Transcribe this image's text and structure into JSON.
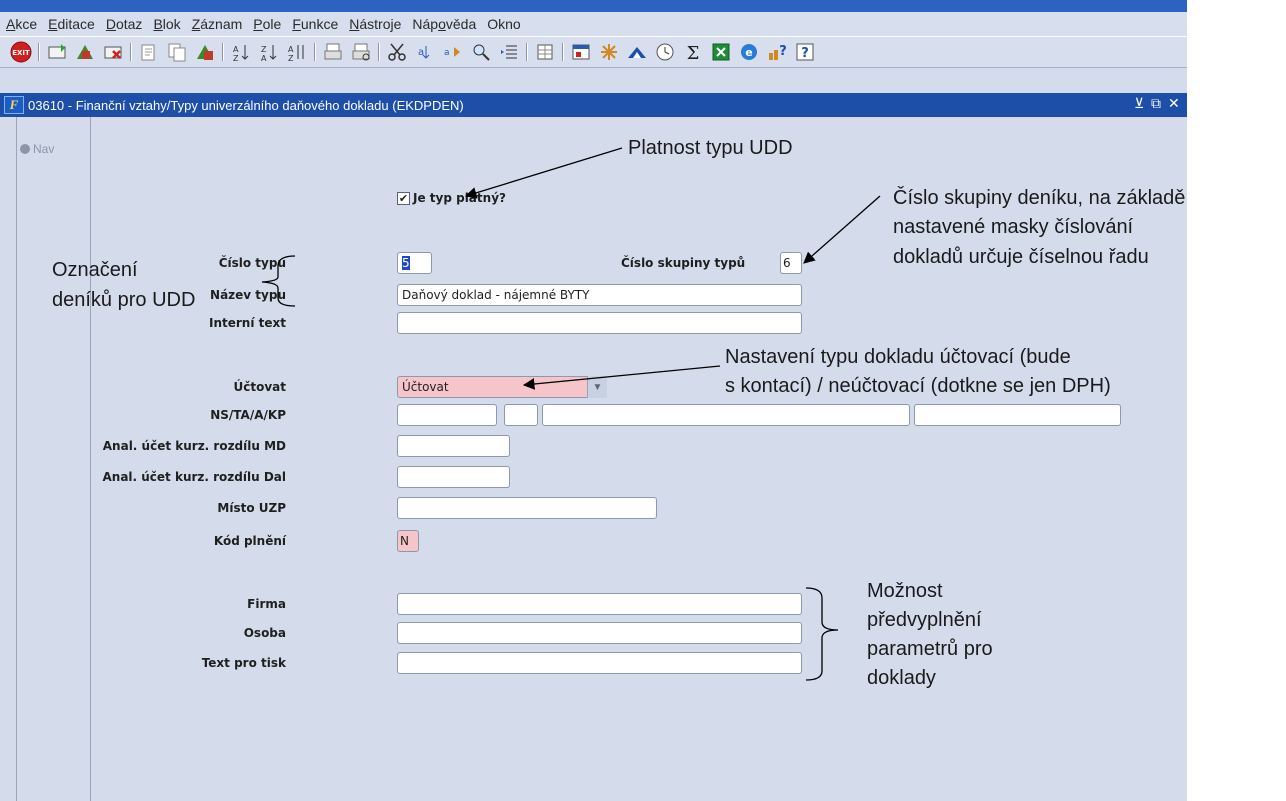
{
  "menubar": {
    "items": [
      {
        "pre": "",
        "key": "A",
        "post": "kce"
      },
      {
        "pre": "",
        "key": "E",
        "post": "ditace"
      },
      {
        "pre": "",
        "key": "D",
        "post": "otaz"
      },
      {
        "pre": "",
        "key": "B",
        "post": "lok"
      },
      {
        "pre": "",
        "key": "Z",
        "post": "áznam"
      },
      {
        "pre": "",
        "key": "P",
        "post": "ole"
      },
      {
        "pre": "",
        "key": "F",
        "post": "unkce"
      },
      {
        "pre": "",
        "key": "N",
        "post": "ástroje"
      },
      {
        "pre": "Náp",
        "key": "o",
        "post": "věda"
      },
      {
        "pre": "Okno",
        "key": "",
        "post": ""
      }
    ]
  },
  "toolbar": {
    "exit_label": "EXIT",
    "icons": [
      "exit-icon",
      "insert-record-icon",
      "duplicate-record-icon",
      "delete-record-icon",
      "cut-icon",
      "copy-icon",
      "paste-icon",
      "sort-asc-icon",
      "sort-desc-icon",
      "sort-multi-icon",
      "print-icon",
      "print-preview-icon",
      "scissors-icon",
      "merge-icon",
      "navigate-icon",
      "query-icon",
      "list-icon",
      "grid-icon",
      "export-icon",
      "tools-icon",
      "triangle-icon",
      "clock-icon",
      "sum-icon",
      "excel-icon",
      "ie-icon",
      "help-context-icon",
      "help-icon"
    ],
    "sum_glyph": "Σ",
    "help_glyph": "?"
  },
  "window": {
    "title": "03610 - Finanční vztahy/Typy univerzálního daňového dokladu (EKDPDEN)",
    "icon_glyph": "F",
    "min_glyph": "⊻",
    "restore_glyph": "⧉",
    "close_glyph": "✕"
  },
  "nav": {
    "label": "Nav"
  },
  "form": {
    "platny_label": "Je typ platný?",
    "platny_check": "✔",
    "cislo_typu_label": "Číslo typu",
    "cislo_typu_value": "5",
    "cislo_skupiny_label": "Číslo skupiny typů",
    "cislo_skupiny_value": "6",
    "nazev_typu_label": "Název typu",
    "nazev_typu_value": "Daňový doklad - nájemné BYTY",
    "interni_text_label": "Interní text",
    "interni_text_value": "",
    "uctovat_label": "Účtovat",
    "uctovat_value": "Účtovat",
    "combo_arrow": "▼",
    "ns_label": "NS/TA/A/KP",
    "md_label": "Anal. účet kurz. rozdílu MD",
    "dal_label": "Anal. účet kurz. rozdílu Dal",
    "misto_label": "Místo UZP",
    "kod_label": "Kód plnění",
    "kod_value": "N",
    "firma_label": "Firma",
    "osoba_label": "Osoba",
    "text_tisk_label": "Text pro tisk"
  },
  "annotations": {
    "platnost": "Platnost typu UDD",
    "cislo_skupiny_1": "Číslo skupiny deníku, na základě",
    "cislo_skupiny_2": "nastavené masky číslování",
    "cislo_skupiny_3": "dokladů určuje číselnou řadu",
    "oznaceni_1": "Označení",
    "oznaceni_2": "deníků pro UDD",
    "nastaveni_1": "Nastavení typu dokladu účtovací (bude",
    "nastaveni_2": "s kontací) / neúčtovací (dotkne se jen DPH)",
    "moznost_1": "Možnost",
    "moznost_2": "předvyplnění",
    "moznost_3": "parametrů pro",
    "moznost_4": "doklady"
  }
}
